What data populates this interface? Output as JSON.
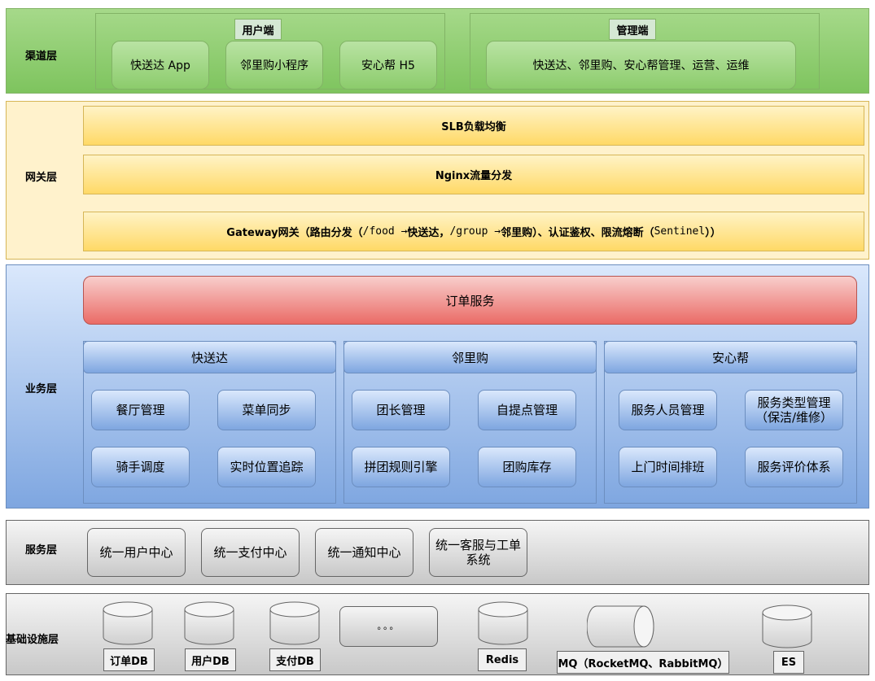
{
  "layers": {
    "channel": "渠道层",
    "gateway": "网关层",
    "business": "业务层",
    "service": "服务层",
    "infra": "基础设施层"
  },
  "channel": {
    "user_side": {
      "title": "用户端",
      "items": [
        "快送达 App",
        "邻里购小程序",
        "安心帮 H5"
      ]
    },
    "admin_side": {
      "title": "管理端",
      "items": [
        "快送达、邻里购、安心帮管理、运营、运维"
      ]
    }
  },
  "gateway": {
    "slb": "SLB负载均衡",
    "nginx": "Nginx流量分发",
    "gw_prefix": "Gateway网关（路由分发（",
    "gw_route1": "/food → ",
    "gw_mid1": "快送达，",
    "gw_route2": "/group → ",
    "gw_mid2": "邻里购）、认证鉴权、限流熔断（",
    "gw_sentinel": "Sentinel",
    "gw_suffix": "））"
  },
  "business": {
    "order_service": "订单服务",
    "groups": [
      {
        "title": "快送达",
        "items": [
          "餐厅管理",
          "菜单同步",
          "骑手调度",
          "实时位置追踪"
        ]
      },
      {
        "title": "邻里购",
        "items": [
          "团长管理",
          "自提点管理",
          "拼团规则引擎",
          "团购库存"
        ]
      },
      {
        "title": "安心帮",
        "items": [
          "服务人员管理",
          "服务类型管理\n（保洁/维修）",
          "上门时间排班",
          "服务评价体系"
        ]
      }
    ]
  },
  "service": {
    "items": [
      "统一用户中心",
      "统一支付中心",
      "统一通知中心",
      "统一客服与工单\n系统"
    ]
  },
  "infra": {
    "order_db": "订单DB",
    "user_db": "用户DB",
    "pay_db": "支付DB",
    "ellipsis": "。。。",
    "redis": "Redis",
    "mq": "MQ（RocketMQ、RabbitMQ）",
    "es": "ES"
  },
  "colors": {
    "channel_green": "#8ccc6c",
    "gateway_yellow": "#ffd966",
    "business_blue": "#7ea6e0",
    "order_red": "#ea6b66",
    "service_grey": "#c8c8c8"
  }
}
